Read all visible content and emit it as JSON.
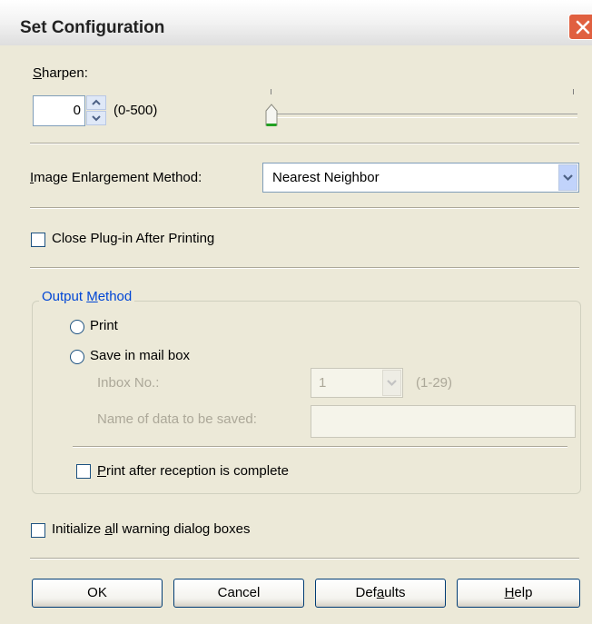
{
  "window": {
    "title": "Set Configuration",
    "close_icon": "close-icon"
  },
  "sharpen": {
    "label_accel": "S",
    "label_rest": "harpen:",
    "value": "0",
    "range": "(0-500)",
    "slider_value": 0,
    "slider_min": 0,
    "slider_max": 500
  },
  "enlargement": {
    "label_accel": "I",
    "label_rest": "mage Enlargement Method:",
    "selected": "Nearest Neighbor"
  },
  "close_plugin": {
    "label": "Close Plug-in After Printing",
    "checked": false
  },
  "output": {
    "title_pre": "Output ",
    "title_accel": "M",
    "title_post": "ethod",
    "print_label": "Print",
    "save_label": "Save in mail box",
    "inbox_label": "Inbox No.:",
    "inbox_value": "1",
    "inbox_range": "(1-29)",
    "data_name_label": "Name of data to be saved:",
    "data_name_value": "",
    "print_after": {
      "accel": "P",
      "rest": "rint after reception is complete",
      "checked": false
    }
  },
  "init_warnings": {
    "pre": "Initialize ",
    "accel": "a",
    "post": "ll warning dialog boxes",
    "checked": false
  },
  "buttons": {
    "ok": "OK",
    "cancel": "Cancel",
    "defaults_pre": "Def",
    "defaults_accel": "a",
    "defaults_post": "ults",
    "help_accel": "H",
    "help_rest": "elp"
  }
}
